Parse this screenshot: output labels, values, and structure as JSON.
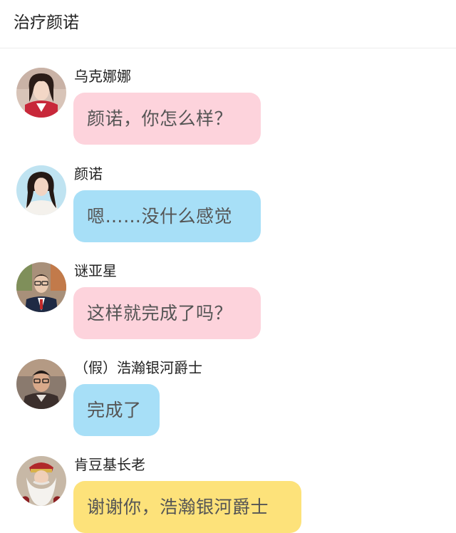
{
  "header": {
    "title": "治疗颜诺"
  },
  "messages": [
    {
      "sender": "乌克娜娜",
      "text": "颜诺，你怎么样？",
      "bubble_color": "#fdd3dc"
    },
    {
      "sender": "颜诺",
      "text": "嗯……没什么感觉",
      "bubble_color": "#a7dff7"
    },
    {
      "sender": "谜亚星",
      "text": "这样就完成了吗？",
      "bubble_color": "#fdd3dc"
    },
    {
      "sender": "（假）浩瀚银河爵士",
      "text": "完成了",
      "bubble_color": "#a7dff7"
    },
    {
      "sender": "肯豆基长老",
      "text": "谢谢你，浩瀚银河爵士",
      "bubble_color": "#fde27a"
    }
  ],
  "colors": {
    "pink_bubble": "#fdd3dc",
    "blue_bubble": "#a7dff7",
    "yellow_bubble": "#fde27a",
    "text": "#555555"
  }
}
